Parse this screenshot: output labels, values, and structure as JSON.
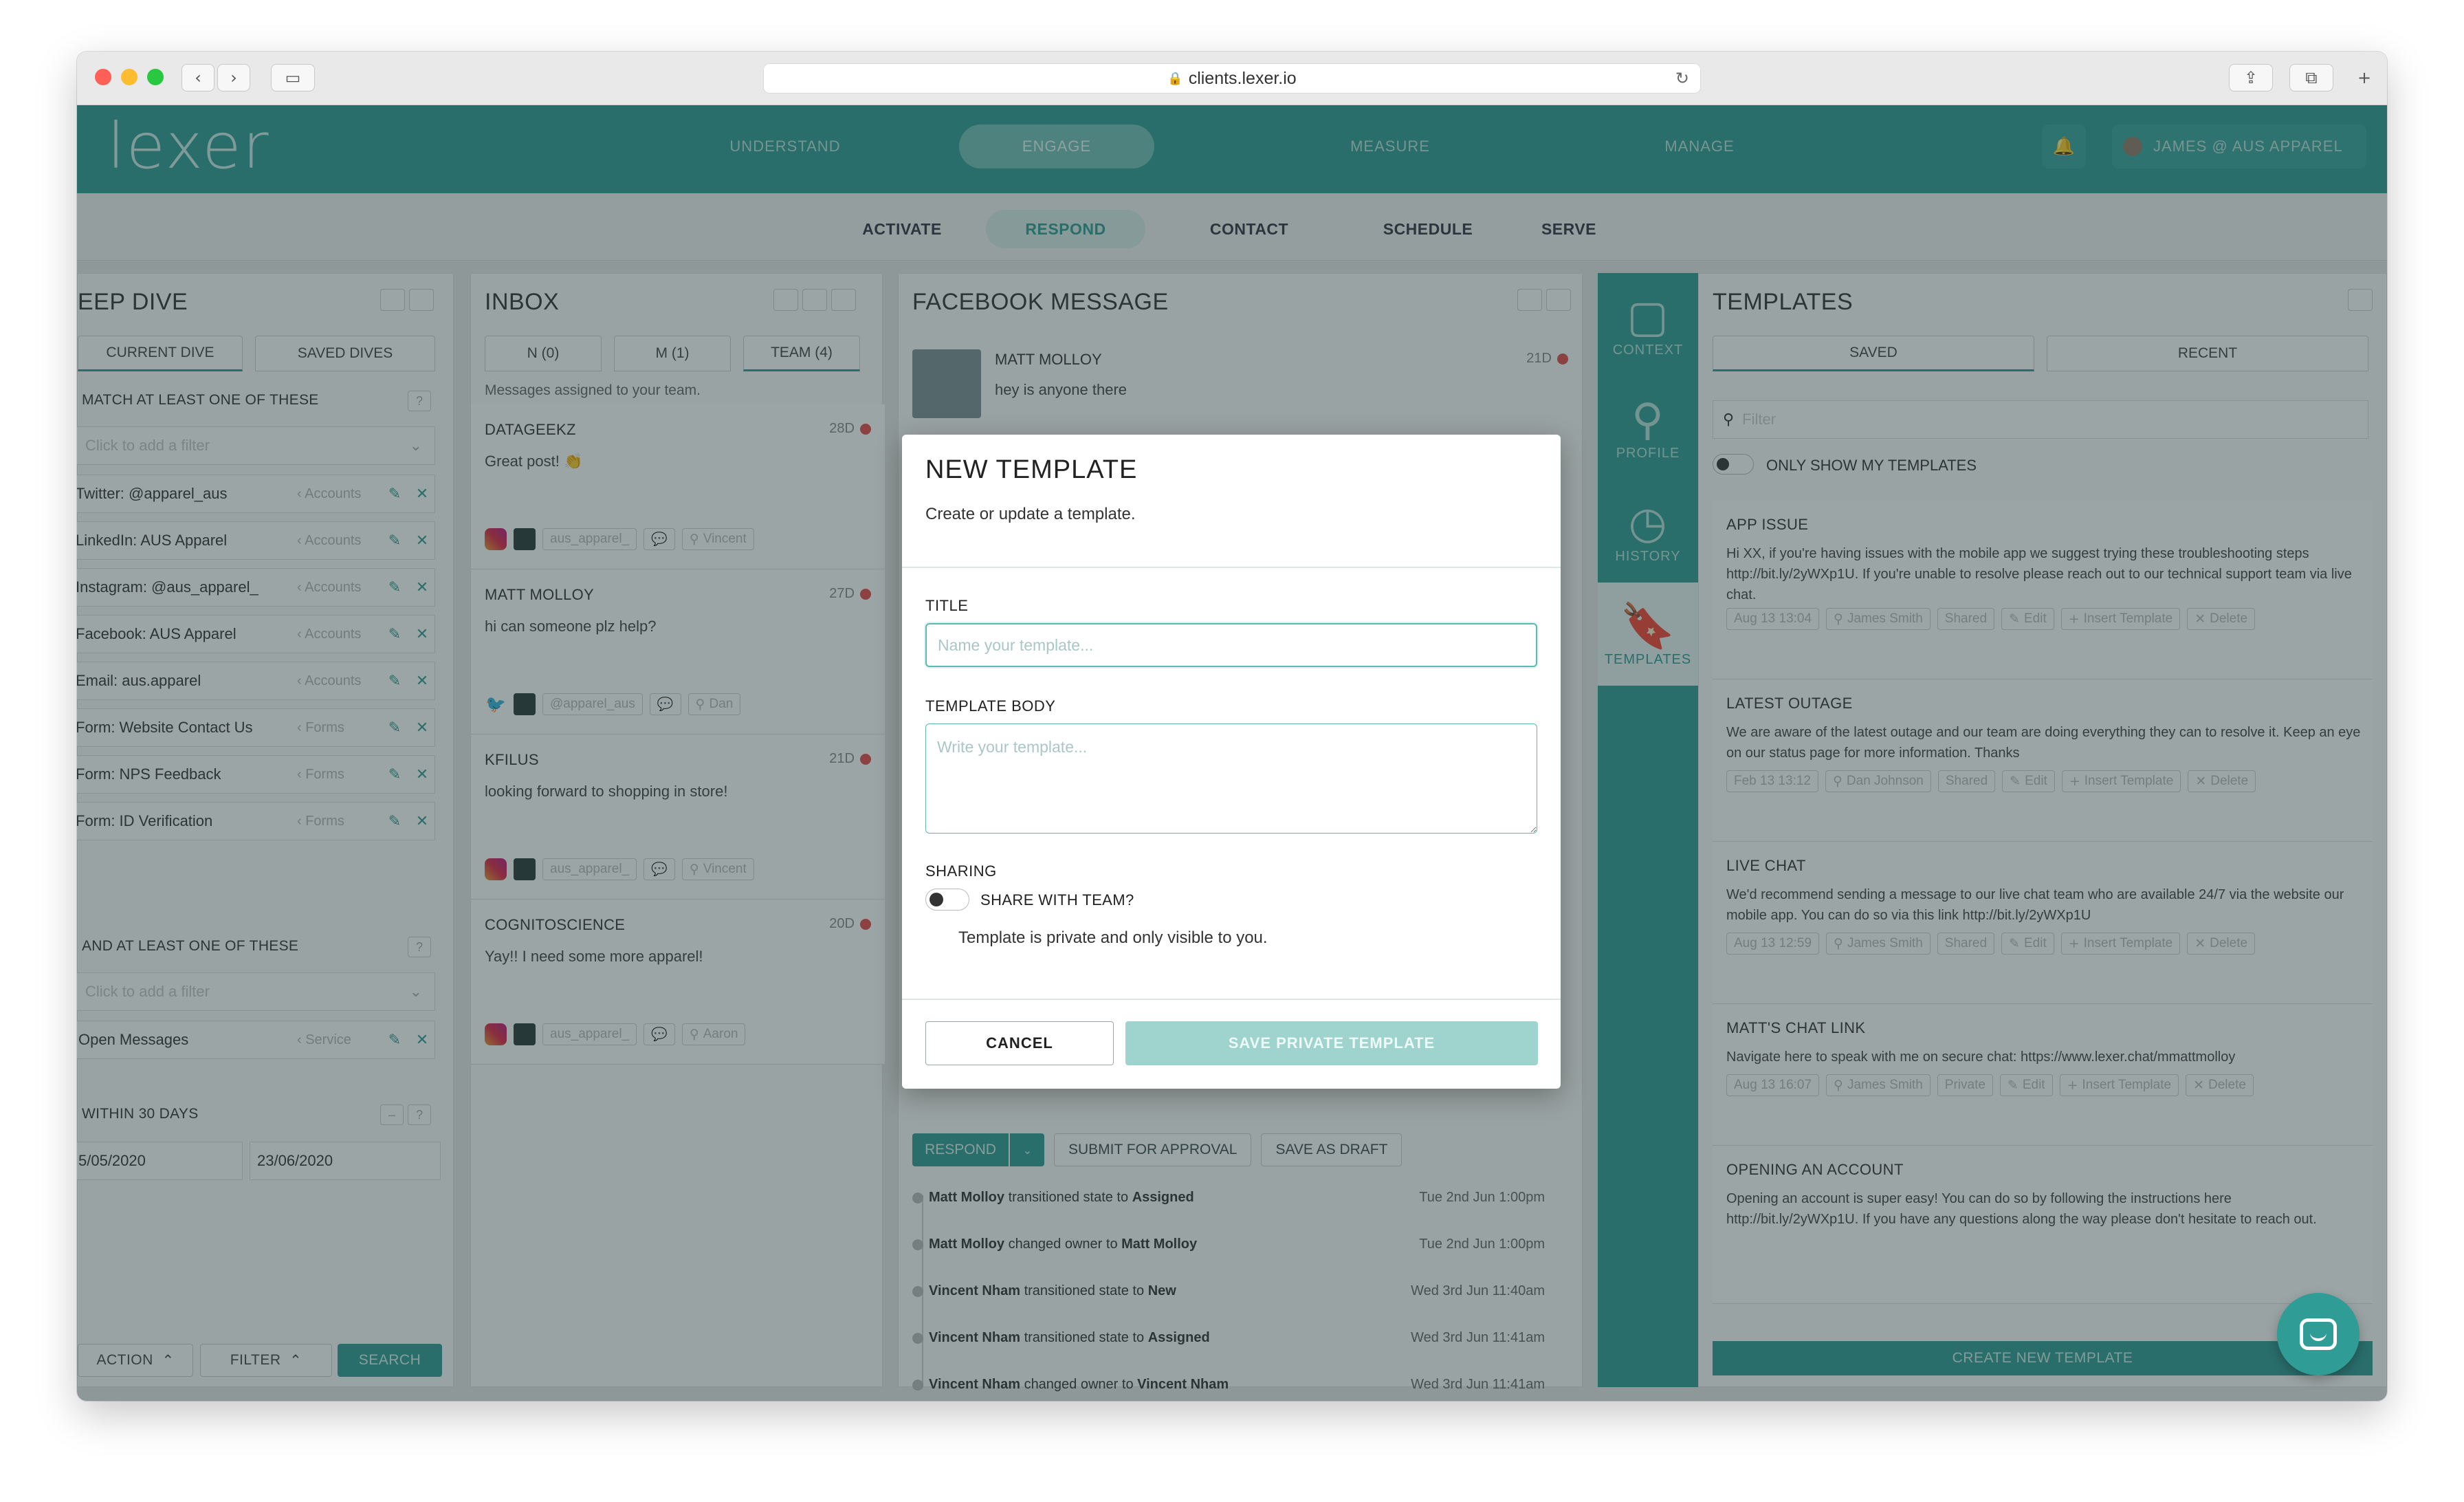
{
  "browser": {
    "url": "clients.lexer.io",
    "traffic_lights": {
      "close": "#fe5f57",
      "minimize": "#febc2e",
      "zoom": "#28c840"
    }
  },
  "colors": {
    "brand": "#2f9c95",
    "unread": "#e44b4b"
  },
  "topnav": {
    "logo": "lexer",
    "items": [
      "UNDERSTAND",
      "ENGAGE",
      "MEASURE",
      "MANAGE"
    ],
    "active": "ENGAGE",
    "user": "JAMES @ AUS APPAREL"
  },
  "subnav": {
    "items": [
      "ACTIVATE",
      "RESPOND",
      "CONTACT",
      "SCHEDULE",
      "SERVE"
    ],
    "active": "RESPOND"
  },
  "deepdive": {
    "title": "EEP DIVE",
    "tabs": [
      "CURRENT DIVE",
      "SAVED DIVES"
    ],
    "match_label": "MATCH AT LEAST ONE OF THESE",
    "filter_placeholder": "Click to add a filter",
    "filters": [
      {
        "label": "Twitter: @apparel_aus",
        "type": "Accounts"
      },
      {
        "label": "LinkedIn: AUS Apparel",
        "type": "Accounts"
      },
      {
        "label": "Instagram: @aus_apparel_",
        "type": "Accounts"
      },
      {
        "label": "Facebook: AUS Apparel",
        "type": "Accounts"
      },
      {
        "label": "Email: aus.apparel",
        "type": "Accounts"
      },
      {
        "label": "Form: Website Contact Us",
        "type": "Forms"
      },
      {
        "label": "Form: NPS Feedback",
        "type": "Forms"
      },
      {
        "label": "Form: ID Verification",
        "type": "Forms"
      }
    ],
    "and_label": "AND AT LEAST ONE OF THESE",
    "and_filters": [
      {
        "label": "Open Messages",
        "type": "Service"
      }
    ],
    "within_label": "WITHIN 30 DAYS",
    "date_from": "5/05/2020",
    "date_to": "23/06/2020",
    "action_label": "ACTION",
    "filter_label": "FILTER",
    "search_label": "SEARCH"
  },
  "inbox": {
    "title": "INBOX",
    "tabs": [
      "N (0)",
      "M (1)",
      "TEAM (4)"
    ],
    "hint": "Messages assigned to your team.",
    "messages": [
      {
        "from": "DATAGEEKZ",
        "age": "28D",
        "body": "Great post! 👏",
        "channel": "instagram",
        "tags": [
          "aus_apparel_",
          "Vincent"
        ]
      },
      {
        "from": "MATT MOLLOY",
        "age": "27D",
        "body": "hi can someone plz help?",
        "channel": "twitter",
        "tags": [
          "@apparel_aus",
          "Dan"
        ]
      },
      {
        "from": "KFILUS",
        "age": "21D",
        "body": "looking forward to shopping in store!",
        "channel": "instagram",
        "tags": [
          "aus_apparel_",
          "Vincent"
        ]
      },
      {
        "from": "COGNITOSCIENCE",
        "age": "20D",
        "body": "Yay!! I need some more apparel!",
        "channel": "instagram",
        "tags": [
          "aus_apparel_",
          "Aaron"
        ]
      }
    ]
  },
  "facebook": {
    "title": "FACEBOOK MESSAGE",
    "sender": "MATT MOLLOY",
    "age": "21D",
    "preview": "hey is anyone there",
    "respond_label": "RESPOND",
    "approval_label": "SUBMIT FOR APPROVAL",
    "draft_label": "SAVE AS DRAFT",
    "history": [
      {
        "actor": "Matt Molloy",
        "action": "transitioned state to",
        "target": "Assigned",
        "time": "Tue 2nd Jun 1:00pm"
      },
      {
        "actor": "Matt Molloy",
        "action": "changed owner to",
        "target": "Matt Molloy",
        "time": "Tue 2nd Jun 1:00pm"
      },
      {
        "actor": "Vincent Nham",
        "action": "transitioned state to",
        "target": "New",
        "time": "Wed 3rd Jun 11:40am"
      },
      {
        "actor": "Vincent Nham",
        "action": "transitioned state to",
        "target": "Assigned",
        "time": "Wed 3rd Jun 11:41am"
      },
      {
        "actor": "Vincent Nham",
        "action": "changed owner to",
        "target": "Vincent Nham",
        "time": "Wed 3rd Jun 11:41am"
      }
    ]
  },
  "rail": {
    "items": [
      {
        "label": "CONTEXT",
        "icon": "speech-bubble-icon"
      },
      {
        "label": "PROFILE",
        "icon": "person-icon"
      },
      {
        "label": "HISTORY",
        "icon": "clock-icon"
      },
      {
        "label": "TEMPLATES",
        "icon": "bookmark-icon"
      }
    ],
    "active": "TEMPLATES"
  },
  "templates": {
    "title": "TEMPLATES",
    "tabs": [
      "SAVED",
      "RECENT"
    ],
    "filter_placeholder": "Filter",
    "only_mine_label": "ONLY SHOW MY TEMPLATES",
    "items": [
      {
        "title": "APP ISSUE",
        "body": "Hi XX, if you're having issues with the mobile app we suggest trying these troubleshooting steps http://bit.ly/2yWXp1U. If you're unable to resolve please reach out to our technical support team via live chat.",
        "date": "Aug 13 13:04",
        "author": "James Smith",
        "share": "Shared"
      },
      {
        "title": "LATEST OUTAGE",
        "body": "We are aware of the latest outage and our team are doing everything they can to resolve it. Keep an eye on our status page for more information. Thanks",
        "date": "Feb 13 13:12",
        "author": "Dan Johnson",
        "share": "Shared"
      },
      {
        "title": "LIVE CHAT",
        "body": "We'd recommend sending a message to our live chat team who are available 24/7 via the website our mobile app. You can do so via this link http://bit.ly/2yWXp1U",
        "date": "Aug 13 12:59",
        "author": "James Smith",
        "share": "Shared"
      },
      {
        "title": "MATT'S CHAT LINK",
        "body": "Navigate here to speak with me on secure chat: https://www.lexer.chat/mmattmolloy",
        "date": "Aug 13 16:07",
        "author": "James Smith",
        "share": "Private"
      },
      {
        "title": "OPENING AN ACCOUNT",
        "body": "Opening an account is super easy! You can do so by following the instructions here http://bit.ly/2yWXp1U. If you have any questions along the way please don't hesitate to reach out.",
        "date": "",
        "author": "",
        "share": ""
      }
    ],
    "edit_label": "Edit",
    "insert_label": "Insert Template",
    "delete_label": "Delete",
    "create_label": "CREATE NEW TEMPLATE"
  },
  "modal": {
    "title": "NEW TEMPLATE",
    "subtitle": "Create or update a template.",
    "title_label": "TITLE",
    "title_placeholder": "Name your template...",
    "body_label": "TEMPLATE BODY",
    "body_placeholder": "Write your template...",
    "sharing_label": "SHARING",
    "share_toggle_label": "SHARE WITH TEAM?",
    "share_toggle_on": false,
    "privacy_note": "Template is private and only visible to you.",
    "cancel_label": "CANCEL",
    "save_label": "SAVE PRIVATE TEMPLATE"
  }
}
